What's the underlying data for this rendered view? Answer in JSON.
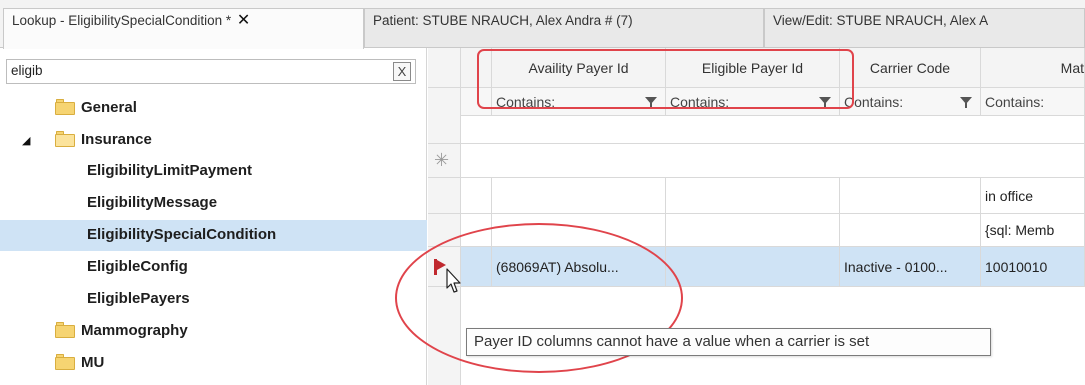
{
  "tabs": [
    {
      "label": "Lookup - EligibilitySpecialCondition *",
      "close": "✕",
      "active": true
    },
    {
      "label": "Patient: STUBE NRAUCH, Alex Andra # (7)"
    },
    {
      "label": "View/Edit: STUBE NRAUCH, Alex A"
    }
  ],
  "search": {
    "value": "eligib",
    "clear_label": "X"
  },
  "tree": {
    "items": [
      {
        "label": "General",
        "type": "folder",
        "level": 1
      },
      {
        "label": "Insurance",
        "type": "folder-open",
        "level": 1,
        "expander": "◢"
      },
      {
        "label": "EligibilityLimitPayment",
        "level": 2
      },
      {
        "label": "EligibilityMessage",
        "level": 2
      },
      {
        "label": "EligibilitySpecialCondition",
        "level": 2,
        "selected": true
      },
      {
        "label": "EligibleConfig",
        "level": 2
      },
      {
        "label": "EligiblePayers",
        "level": 2
      },
      {
        "label": "Mammography",
        "type": "folder",
        "level": 1
      },
      {
        "label": "MU",
        "type": "folder",
        "level": 1
      }
    ]
  },
  "grid": {
    "columns": [
      "Availity Payer Id",
      "Eligible Payer Id",
      "Carrier Code",
      "Mat"
    ],
    "filter_label": "Contains:",
    "new_row_icon": "✳",
    "rows": [
      {
        "cells": [
          "",
          "",
          "",
          "in office"
        ]
      },
      {
        "cells": [
          "",
          "",
          "",
          "{sql: Memb"
        ]
      },
      {
        "cells": [
          "(68069AT) Absolu...",
          "",
          "Inactive - 0100...",
          "10010010"
        ],
        "selected": true,
        "error": true
      }
    ]
  },
  "tooltip": {
    "text": "Payer ID columns cannot have a value when a carrier is set"
  },
  "colors": {
    "accent_red": "#e0444b",
    "selection": "#cfe3f5",
    "error_flag": "#c0292f"
  }
}
